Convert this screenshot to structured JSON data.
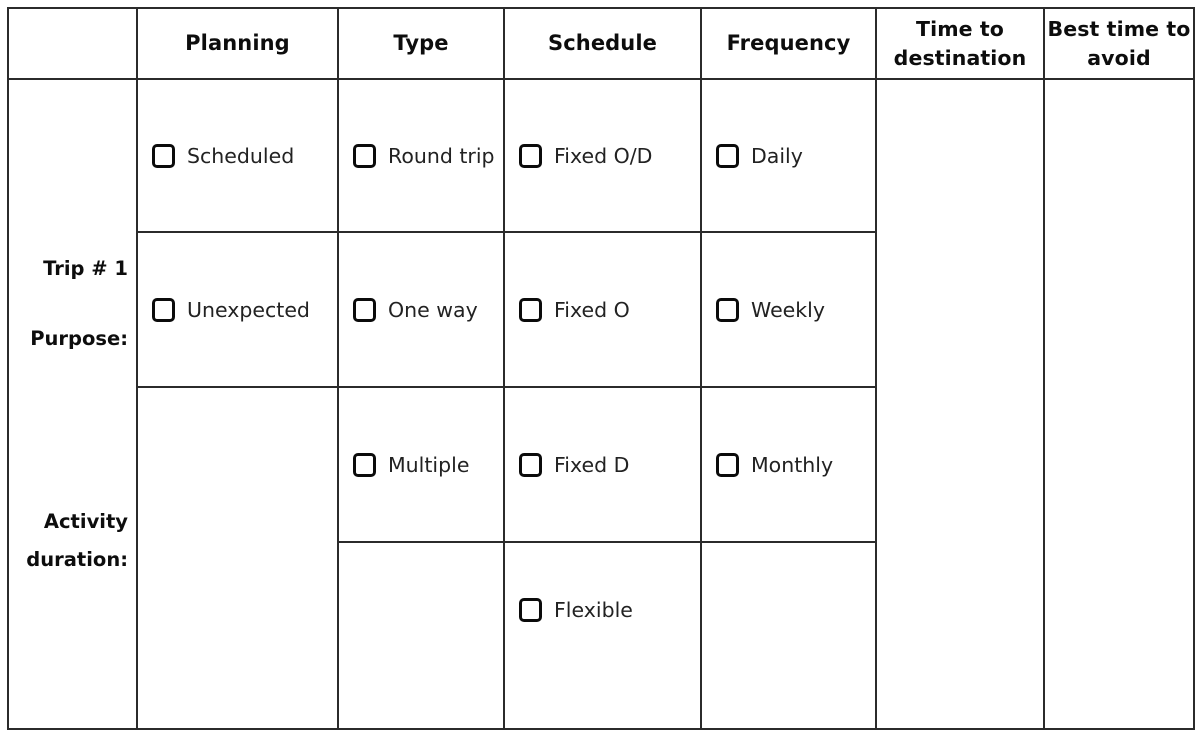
{
  "table": {
    "headers": [
      {
        "id": "corner",
        "label": ""
      },
      {
        "id": "planning",
        "label": "Planning"
      },
      {
        "id": "type",
        "label": "Type"
      },
      {
        "id": "schedule",
        "label": "Schedule"
      },
      {
        "id": "frequency",
        "label": "Frequency"
      },
      {
        "id": "time-to-destination",
        "line1": "Time to",
        "line2": "destination"
      },
      {
        "id": "best-time-to-avoid",
        "line1": "Best time to",
        "line2": "avoid"
      }
    ],
    "row_labels": {
      "trip": "Trip # 1",
      "purpose": "Purpose:",
      "activity_line1": "Activity",
      "activity_line2": "duration:"
    },
    "rows": [
      {
        "id": "row-1",
        "planning": {
          "label": "Scheduled",
          "checked": false
        },
        "type": {
          "label": "Round trip",
          "checked": false
        },
        "schedule": {
          "label": "Fixed O/D",
          "checked": false
        },
        "frequency": {
          "label": "Daily",
          "checked": false
        }
      },
      {
        "id": "row-2",
        "planning": {
          "label": "Unexpected",
          "checked": false
        },
        "type": {
          "label": "One way",
          "checked": false
        },
        "schedule": {
          "label": "Fixed O",
          "checked": false
        },
        "frequency": {
          "label": "Weekly",
          "checked": false
        }
      },
      {
        "id": "row-3",
        "planning": {
          "label": "",
          "checked": false
        },
        "type": {
          "label": "Multiple",
          "checked": false
        },
        "schedule": {
          "label": "Fixed D",
          "checked": false
        },
        "frequency": {
          "label": "Monthly",
          "checked": false
        }
      },
      {
        "id": "row-4",
        "planning": {
          "label": "",
          "checked": false
        },
        "type": {
          "label": "",
          "checked": false
        },
        "schedule": {
          "label": "Flexible",
          "checked": false
        },
        "frequency": {
          "label": "",
          "checked": false
        }
      }
    ],
    "time_to_destination_value": "",
    "best_time_to_avoid_value": ""
  },
  "style": {
    "border_color": "#2b2b2b",
    "checkbox_color": "#0b0b0b",
    "text_color": "#222222",
    "background": "#ffffff"
  }
}
